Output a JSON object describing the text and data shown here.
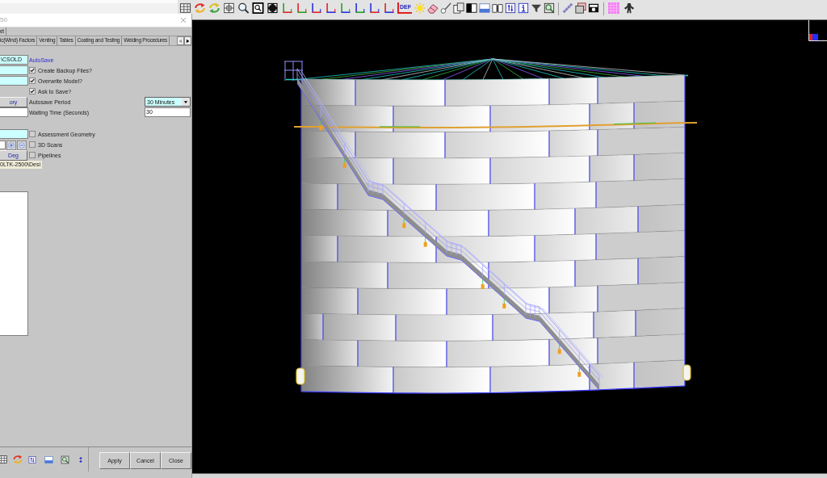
{
  "view_toolbar": {
    "text_button": "DEF"
  },
  "dialog": {
    "title": "50",
    "tab_rows": [
      {
        "tabs": [
          {
            "label": "et"
          }
        ]
      },
      {
        "tabs": [
          {
            "label": "ic(Wind) Factors"
          },
          {
            "label": "Venting"
          },
          {
            "label": "Tables"
          },
          {
            "label": "Coating and Testing"
          },
          {
            "label": "Welding Procedures"
          }
        ]
      }
    ],
    "autosave_rows": [
      {
        "left": {
          "kind": "field",
          "highlighted": true,
          "value": "\\CSOLD"
        },
        "middle": {
          "kind": "heading",
          "text": "AutoSave"
        }
      },
      {
        "left": {
          "kind": "field",
          "highlighted": true
        },
        "middle": {
          "kind": "checkbox",
          "label": "Create Backup Files?",
          "checked": true
        }
      },
      {
        "left": {
          "kind": "field",
          "highlighted": true
        },
        "middle": {
          "kind": "checkbox",
          "label": "Overwrite Model?",
          "checked": true
        }
      },
      {
        "middle": {
          "kind": "checkbox",
          "label": "Ask to Save?",
          "checked": true
        }
      },
      {
        "left": {
          "kind": "button",
          "label": "ory"
        },
        "middle": {
          "kind": "label",
          "text": "Autosave Period"
        },
        "right": {
          "kind": "dropdown",
          "highlighted": true,
          "value": "30 Minutes"
        }
      },
      {
        "left": {
          "kind": "field",
          "highlighted": false
        },
        "middle": {
          "kind": "label",
          "text": "Waiting Time (Seconds)"
        },
        "right": {
          "kind": "field",
          "highlighted": false,
          "value": "30"
        }
      }
    ],
    "geometry_rows": [
      {
        "left": {
          "kind": "field",
          "highlighted": true
        },
        "middle": {
          "kind": "checkbox",
          "label": "Assessment Geometry",
          "checked": false
        }
      },
      {
        "left": {
          "kind": "spinner"
        },
        "middle": {
          "kind": "checkbox",
          "label": "3D Scans",
          "checked": false
        }
      },
      {
        "left": {
          "kind": "button",
          "label": "Deg"
        },
        "middle": {
          "kind": "checkbox",
          "label": "Pipelines",
          "checked": false
        }
      },
      {
        "left": {
          "kind": "note",
          "text": "0LTK-2500\\Desi"
        }
      }
    ],
    "buttons": [
      {
        "label": "Apply"
      },
      {
        "label": "Cancel"
      },
      {
        "label": "Close"
      }
    ]
  }
}
